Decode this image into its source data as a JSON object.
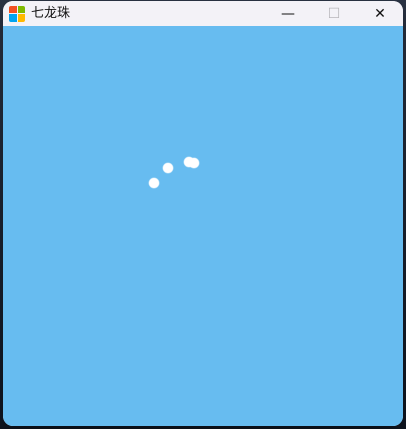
{
  "window": {
    "title": "七龙珠",
    "client_background": "#67bcf0",
    "controls": {
      "minimize_icon": "minimize-icon",
      "maximize_icon": "maximize-icon",
      "close_icon": "close-icon"
    }
  },
  "app_icon": {
    "name": "app-icon",
    "colors": [
      "#f25022",
      "#7fba00",
      "#00a4ef",
      "#ffb900"
    ]
  },
  "scene": {
    "dots": [
      {
        "name": "dot-1"
      },
      {
        "name": "dot-2"
      },
      {
        "name": "dot-3"
      },
      {
        "name": "dot-4"
      }
    ],
    "dot_color": "#ffffff"
  }
}
